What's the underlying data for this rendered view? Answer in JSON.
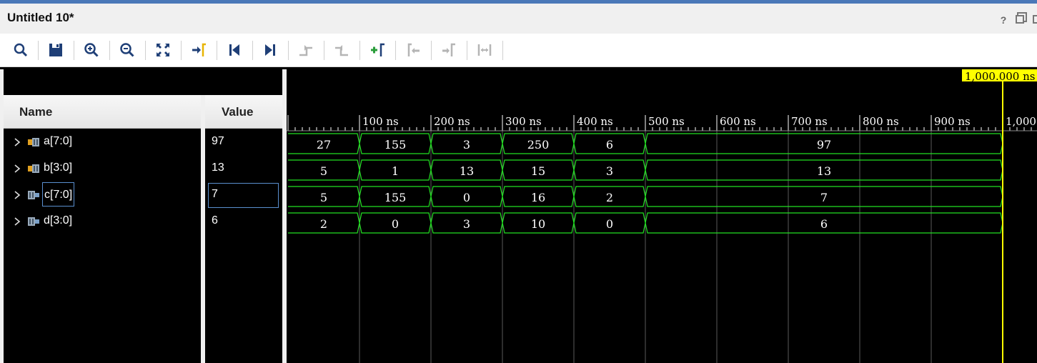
{
  "window": {
    "title": "Untitled 10*",
    "help_glyph": "?"
  },
  "toolbar": {
    "buttons": [
      {
        "name": "search-icon",
        "enabled": true
      },
      {
        "name": "save-icon",
        "enabled": true
      },
      {
        "name": "zoom-in-icon",
        "enabled": true
      },
      {
        "name": "zoom-out-icon",
        "enabled": true
      },
      {
        "name": "zoom-fit-icon",
        "enabled": true
      },
      {
        "name": "go-to-cursor-icon",
        "enabled": true
      },
      {
        "name": "go-to-time-0-icon",
        "enabled": true
      },
      {
        "name": "go-to-last-time-icon",
        "enabled": true
      },
      {
        "name": "previous-transition-icon",
        "enabled": false
      },
      {
        "name": "next-transition-icon",
        "enabled": false
      },
      {
        "name": "add-marker-icon",
        "enabled": true
      },
      {
        "name": "previous-marker-icon",
        "enabled": false
      },
      {
        "name": "next-marker-icon",
        "enabled": false
      },
      {
        "name": "swap-cursors-icon",
        "enabled": false
      }
    ]
  },
  "columns": {
    "name": "Name",
    "value": "Value"
  },
  "signals": [
    {
      "name": "a[7:0]",
      "value": "97",
      "icon": "input-bus-icon",
      "selected": false
    },
    {
      "name": "b[3:0]",
      "value": "13",
      "icon": "input-bus-icon",
      "selected": false
    },
    {
      "name": "c[7:0]",
      "value": "7",
      "icon": "output-bus-icon",
      "selected": true
    },
    {
      "name": "d[3:0]",
      "value": "6",
      "icon": "output-bus-icon",
      "selected": false
    }
  ],
  "timeline": {
    "unit": "ns",
    "tick_labels": [
      "100 ns",
      "200 ns",
      "300 ns",
      "400 ns",
      "500 ns",
      "600 ns",
      "700 ns",
      "800 ns",
      "900 ns",
      "1,000"
    ],
    "cursor_label": "1,000.000 ns",
    "cursor_time": 1000,
    "view_end": 1048
  },
  "waveforms": [
    {
      "signal": "a[7:0]",
      "segments": [
        {
          "start": 0,
          "end": 100,
          "value": "27"
        },
        {
          "start": 100,
          "end": 200,
          "value": "155"
        },
        {
          "start": 200,
          "end": 300,
          "value": "3"
        },
        {
          "start": 300,
          "end": 400,
          "value": "250"
        },
        {
          "start": 400,
          "end": 500,
          "value": "6"
        },
        {
          "start": 500,
          "end": 1000,
          "value": "97"
        }
      ]
    },
    {
      "signal": "b[3:0]",
      "segments": [
        {
          "start": 0,
          "end": 100,
          "value": "5"
        },
        {
          "start": 100,
          "end": 200,
          "value": "1"
        },
        {
          "start": 200,
          "end": 300,
          "value": "13"
        },
        {
          "start": 300,
          "end": 400,
          "value": "15"
        },
        {
          "start": 400,
          "end": 500,
          "value": "3"
        },
        {
          "start": 500,
          "end": 1000,
          "value": "13"
        }
      ]
    },
    {
      "signal": "c[7:0]",
      "segments": [
        {
          "start": 0,
          "end": 100,
          "value": "5"
        },
        {
          "start": 100,
          "end": 200,
          "value": "155"
        },
        {
          "start": 200,
          "end": 300,
          "value": "0"
        },
        {
          "start": 300,
          "end": 400,
          "value": "16"
        },
        {
          "start": 400,
          "end": 500,
          "value": "2"
        },
        {
          "start": 500,
          "end": 1000,
          "value": "7"
        }
      ]
    },
    {
      "signal": "d[3:0]",
      "segments": [
        {
          "start": 0,
          "end": 100,
          "value": "2"
        },
        {
          "start": 100,
          "end": 200,
          "value": "0"
        },
        {
          "start": 200,
          "end": 300,
          "value": "3"
        },
        {
          "start": 300,
          "end": 400,
          "value": "10"
        },
        {
          "start": 400,
          "end": 500,
          "value": "0"
        },
        {
          "start": 500,
          "end": 1000,
          "value": "6"
        }
      ]
    }
  ],
  "colors": {
    "wave": "#22e022",
    "cursor": "#ffff00",
    "grid": "#5a5a5a",
    "background": "#000000"
  }
}
